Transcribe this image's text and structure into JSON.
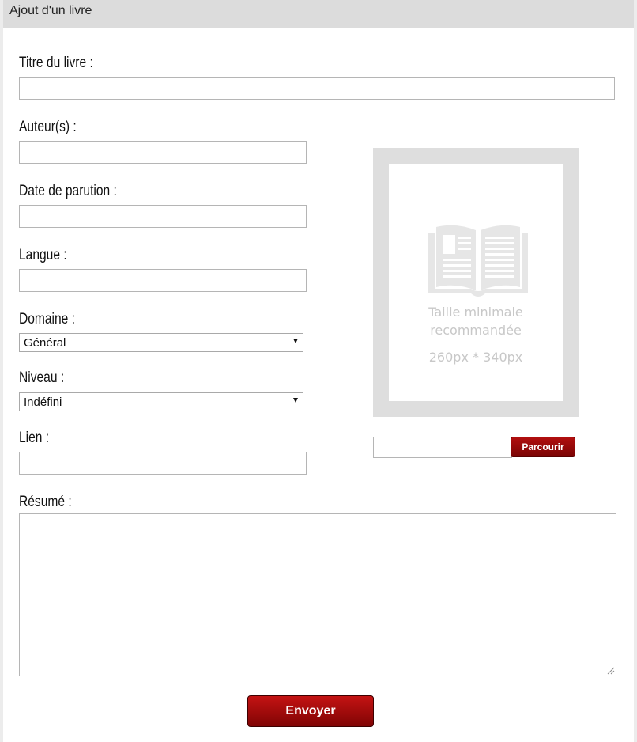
{
  "header": {
    "title": "Ajout d'un livre"
  },
  "form": {
    "title_label": "Titre du livre :",
    "title_value": "",
    "authors_label": "Auteur(s) :",
    "authors_value": "",
    "date_label": "Date de parution :",
    "date_value": "",
    "language_label": "Langue :",
    "language_value": "",
    "domain_label": "Domaine :",
    "domain_selected": "Général",
    "level_label": "Niveau :",
    "level_selected": "Indéfini",
    "link_label": "Lien :",
    "link_value": "",
    "summary_label": "Résumé :",
    "summary_value": "",
    "submit_label": "Envoyer"
  },
  "cover": {
    "icon": "open-book-icon",
    "hint_line1": "Taille minimale",
    "hint_line2": "recommandée",
    "hint_size": "260px * 340px",
    "browse_label": "Parcourir",
    "file_value": ""
  },
  "colors": {
    "accent": "#a00a0a",
    "header_bg": "#dcdcdc",
    "placeholder_grey": "#dedede"
  }
}
